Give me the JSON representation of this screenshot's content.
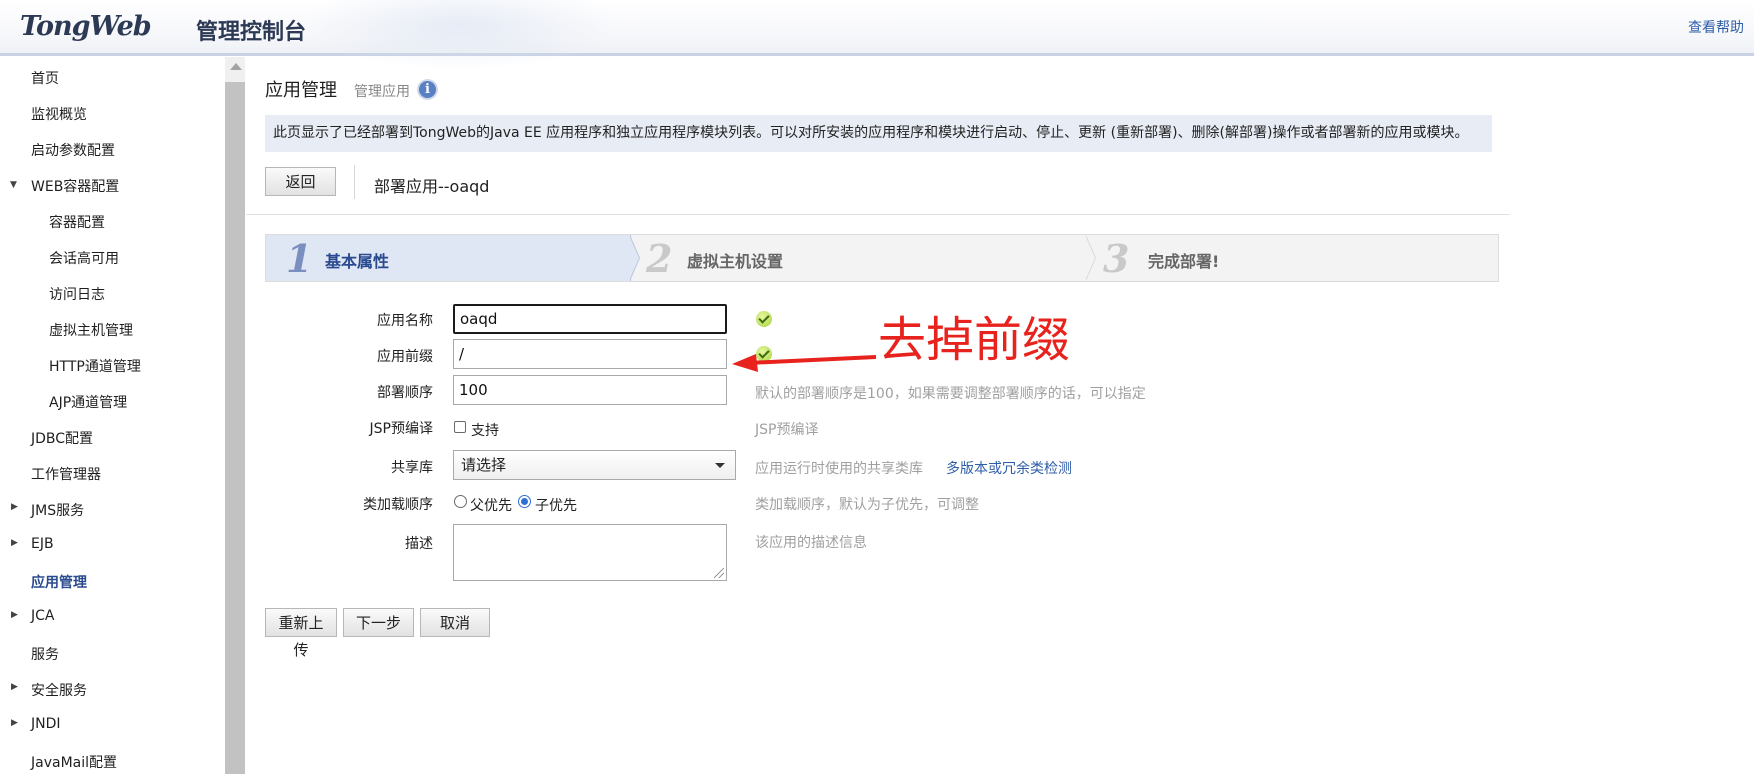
{
  "header": {
    "logo_text": "TongWeb",
    "title": "管理控制台",
    "help": "查看帮助"
  },
  "sidebar": {
    "items": [
      {
        "label": "首页"
      },
      {
        "label": "监视概览"
      },
      {
        "label": "启动参数配置"
      },
      {
        "label": "WEB容器配置",
        "expanded": true
      },
      {
        "label": "容器配置"
      },
      {
        "label": "会话高可用"
      },
      {
        "label": "访问日志"
      },
      {
        "label": "虚拟主机管理"
      },
      {
        "label": "HTTP通道管理"
      },
      {
        "label": "AJP通道管理"
      },
      {
        "label": "JDBC配置"
      },
      {
        "label": "工作管理器"
      },
      {
        "label": "JMS服务",
        "collapsed": true
      },
      {
        "label": "EJB",
        "collapsed": true
      },
      {
        "label": "应用管理",
        "active": true
      },
      {
        "label": "JCA",
        "collapsed": true
      },
      {
        "label": "服务"
      },
      {
        "label": "安全服务",
        "collapsed": true
      },
      {
        "label": "JNDI",
        "collapsed": true
      },
      {
        "label": "JavaMail配置"
      }
    ]
  },
  "main": {
    "title": "应用管理",
    "subtitle": "管理应用",
    "info_icon": "i",
    "description": "此页显示了已经部署到TongWeb的Java EE 应用程序和独立应用程序模块列表。可以对所安装的应用程序和模块进行启动、停止、更新 (重新部署)、删除(解部署)操作或者部署新的应用或模块。",
    "back_button": "返回",
    "deploy_title": "部署应用--oaqd"
  },
  "steps": [
    {
      "num": "1",
      "label": "基本属性",
      "active": true
    },
    {
      "num": "2",
      "label": "虚拟主机设置",
      "active": false
    },
    {
      "num": "3",
      "label": "完成部署!",
      "active": false
    }
  ],
  "form": {
    "app_name_label": "应用名称",
    "app_name_value": "oaqd",
    "prefix_label": "应用前缀",
    "prefix_value": "/",
    "order_label": "部署顺序",
    "order_value": "100",
    "order_hint": "默认的部署顺序是100，如果需要调整部署顺序的话，可以指定",
    "jsp_label": "JSP预编译",
    "jsp_checkbox_label": "支持",
    "jsp_checked": false,
    "jsp_hint": "JSP预编译",
    "shared_lib_label": "共享库",
    "shared_lib_value": "请选择",
    "shared_lib_hint": "应用运行时使用的共享类库",
    "shared_lib_link": "多版本或冗余类检测",
    "classload_label": "类加载顺序",
    "classload_parent": "父优先",
    "classload_child": "子优先",
    "classload_selected": "子优先",
    "classload_hint": "类加载顺序，默认为子优先，可调整",
    "desc_label": "描述",
    "desc_value": "",
    "desc_hint": "该应用的描述信息"
  },
  "actions": {
    "reupload": "重新上传",
    "next": "下一步",
    "cancel": "取消"
  },
  "annotation": {
    "text": "去掉前缀",
    "color": "#e8221c"
  },
  "colors": {
    "accent": "#2a4a8f",
    "link": "#2f5ea8",
    "desc_bar": "#e8ecf5",
    "step_active": "#dfe6f4"
  }
}
